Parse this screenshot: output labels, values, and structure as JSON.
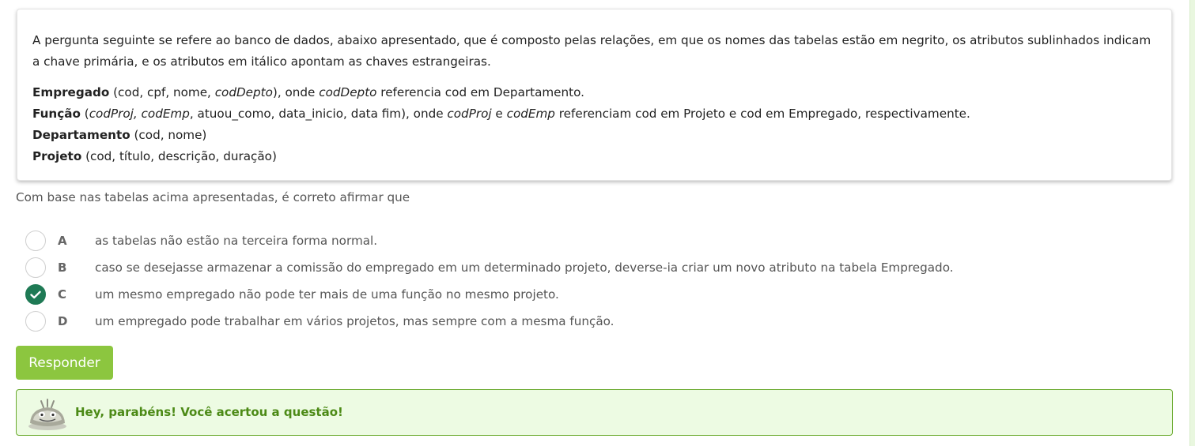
{
  "intro": "A pergunta seguinte se refere ao banco de dados, abaixo apresentado, que é composto pelas relações, em que os nomes das tabelas estão em negrito, os atributos sublinhados indicam a chave primária, e os atributos em itálico apontam as chaves estrangeiras.",
  "relations": {
    "empregado": {
      "name": "Empregado",
      "open": " (cod, cpf, nome, ",
      "fk": "codDepto",
      "mid": "), onde ",
      "fk2": "codDepto",
      "end": " referencia cod em Departamento."
    },
    "funcao": {
      "name": "Função",
      "open": " (",
      "fk": "codProj, codEmp",
      "mid": ", atuou_como, data_inicio, data fim), onde ",
      "fk2": "codProj",
      "and": " e ",
      "fk3": "codEmp",
      "end": " referenciam cod em Projeto e cod em Empregado, respectivamente."
    },
    "departamento": {
      "name": "Departamento",
      "rest": " (cod, nome)"
    },
    "projeto": {
      "name": "Projeto",
      "rest": " (cod, título, descrição, duração)"
    }
  },
  "question": "Com base nas tabelas acima apresentadas, é correto afirmar que",
  "options": [
    {
      "letter": "A",
      "text": "as tabelas não estão na terceira forma normal.",
      "selected": false
    },
    {
      "letter": "B",
      "text": "caso se desejasse armazenar a comissão do empregado em um determinado projeto, deverse-ia criar um novo atributo na tabela Empregado.",
      "selected": false
    },
    {
      "letter": "C",
      "text": "um mesmo empregado não pode ter mais de uma função no mesmo projeto.",
      "selected": true
    },
    {
      "letter": "D",
      "text": "um empregado pode trabalhar em vários projetos, mas sempre com a mesma função.",
      "selected": false
    }
  ],
  "submit_label": "Responder",
  "feedback": "Hey, parabéns! Você acertou a questão!",
  "colors": {
    "accent": "#8cc63f",
    "selected": "#1f7a55",
    "success_bg": "#edfbe3",
    "success_text": "#4c8a16"
  },
  "icons": {
    "check": "check-icon",
    "mascot": "mascot-icon"
  }
}
